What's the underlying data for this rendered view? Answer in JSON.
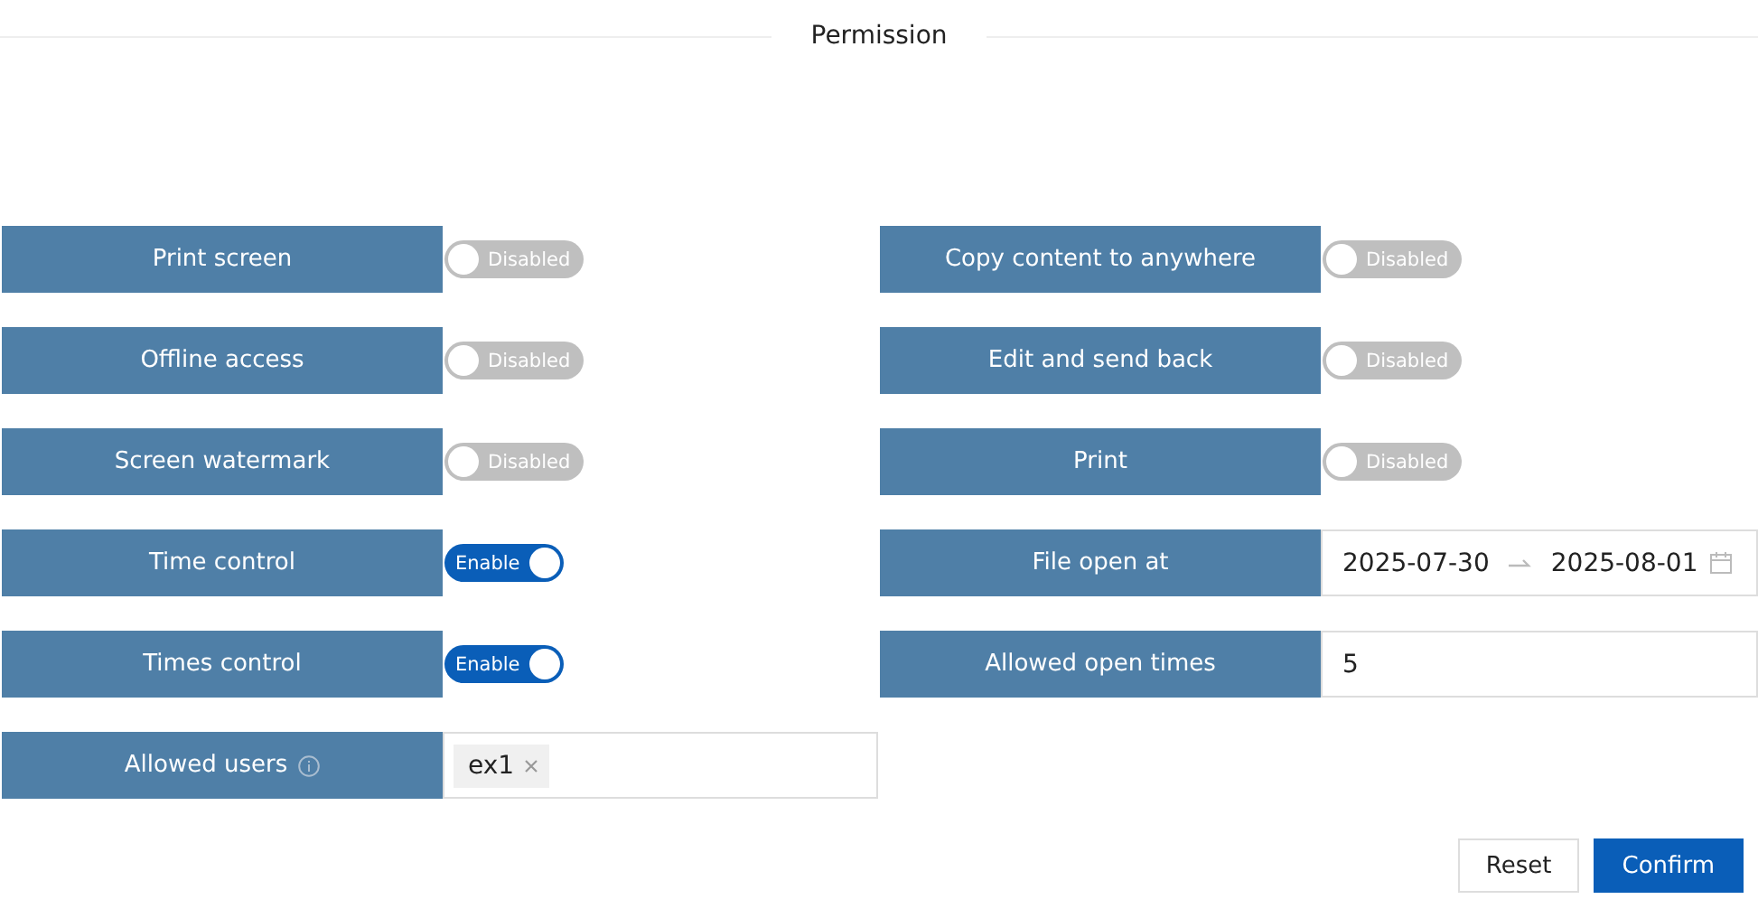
{
  "title": "Permission",
  "fields": [
    {
      "kind": "toggle",
      "label": "Print screen",
      "on": false,
      "state_text": "Disabled"
    },
    {
      "kind": "toggle",
      "label": "Copy content to anywhere",
      "on": false,
      "state_text": "Disabled"
    },
    {
      "kind": "toggle",
      "label": "Offline access",
      "on": false,
      "state_text": "Disabled"
    },
    {
      "kind": "toggle",
      "label": "Edit and send back",
      "on": false,
      "state_text": "Disabled"
    },
    {
      "kind": "toggle",
      "label": "Screen watermark",
      "on": false,
      "state_text": "Disabled"
    },
    {
      "kind": "toggle",
      "label": "Print",
      "on": false,
      "state_text": "Disabled"
    },
    {
      "kind": "toggle",
      "label": "Time control",
      "on": true,
      "state_text": "Enable"
    },
    {
      "kind": "date_range",
      "label": "File open at",
      "start": "2025-07-30",
      "end": "2025-08-01"
    },
    {
      "kind": "toggle",
      "label": "Times control",
      "on": true,
      "state_text": "Enable"
    },
    {
      "kind": "number",
      "label": "Allowed open times",
      "value": "5"
    },
    {
      "kind": "tags",
      "label": "Allowed users",
      "info": true,
      "tags": [
        "ex1"
      ]
    }
  ],
  "buttons": [
    {
      "label": "Reset",
      "primary": false
    },
    {
      "label": "Confirm",
      "primary": true
    }
  ]
}
